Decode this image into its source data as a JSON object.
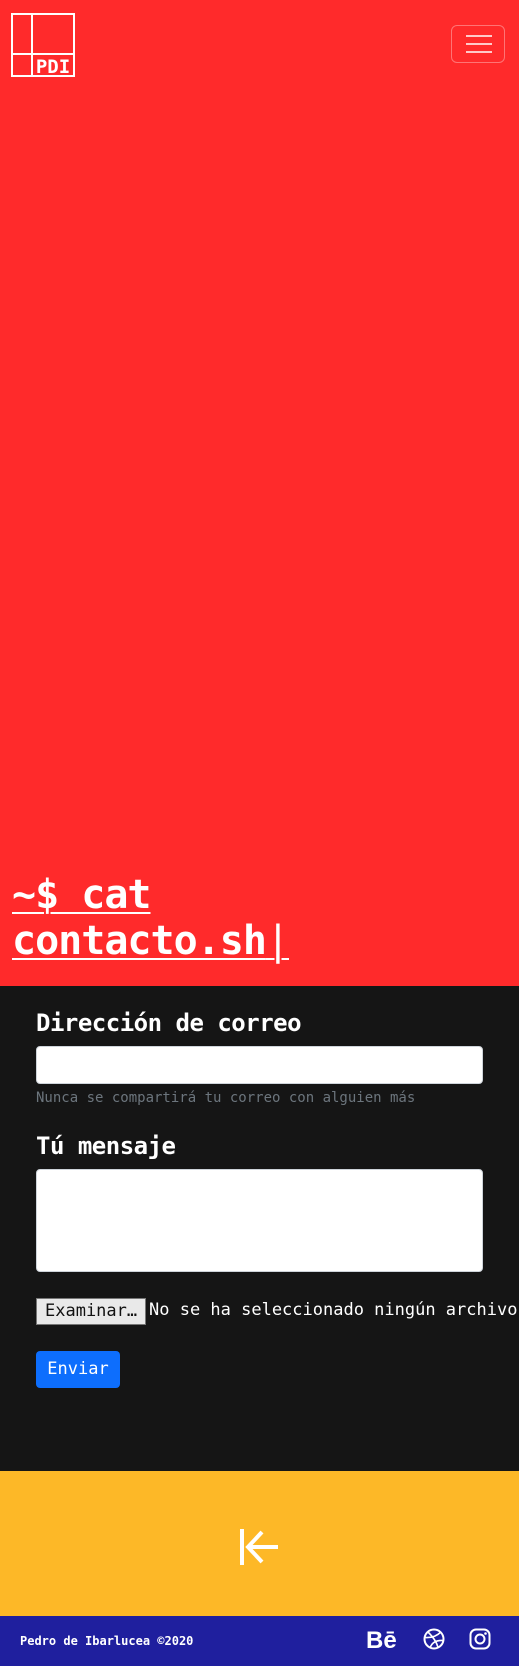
{
  "header": {
    "logo_text": "PDI",
    "menu_icon": "hamburger-icon"
  },
  "hero": {
    "command_line1": "~$ cat",
    "command_line2": "contacto.sh",
    "cursor": "|"
  },
  "form": {
    "email_label": "Dirección de correo",
    "email_value": "",
    "email_help": "Nunca se compartirá tu correo con alguien más",
    "message_label": "Tú mensaje",
    "message_value": "",
    "file_button": "Examinar…",
    "file_status": "No se ha seleccionado ningún archivo.",
    "submit_label": "Enviar"
  },
  "back": {
    "icon": "arrow-left-to-line-icon"
  },
  "footer": {
    "credit": "Pedro de Ibarlucea ©2020",
    "behance_label": "Bē",
    "social_icons": [
      "behance-icon",
      "dribbble-icon",
      "instagram-icon"
    ]
  },
  "colors": {
    "hero_bg": "#ff2a2b",
    "form_bg": "#151515",
    "back_bg": "#fdb827",
    "footer_bg": "#1f1f9e",
    "primary": "#0d6efd"
  }
}
